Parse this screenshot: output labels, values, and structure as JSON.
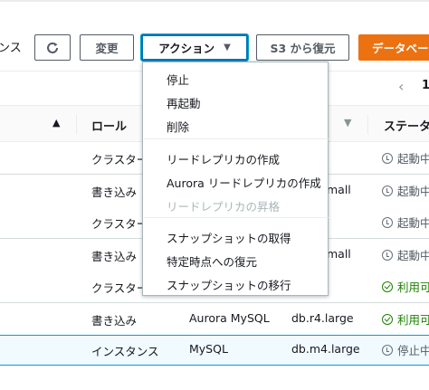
{
  "toolbar": {
    "left_label": "ンス",
    "edit_label": "変更",
    "action_label": "アクション",
    "s3_restore_label": "S3 から復元",
    "create_label": "データベー"
  },
  "pager": {
    "current_page": "1"
  },
  "table": {
    "headers": {
      "role": "ロール",
      "status": "ステータ"
    },
    "rows": [
      {
        "role": "クラスター",
        "engine": "",
        "size": "",
        "status": "起動中",
        "status_kind": "pending"
      },
      {
        "role": "書き込み",
        "engine": "",
        "size": "mall",
        "status": "起動中",
        "status_kind": "pending"
      },
      {
        "role": "クラスター",
        "engine": "",
        "size": "",
        "status": "起動中",
        "status_kind": "pending"
      },
      {
        "role": "書き込み",
        "engine": "",
        "size": "mall",
        "status": "起動中",
        "status_kind": "pending"
      },
      {
        "role": "クラスター",
        "engine": "",
        "size": "",
        "status": "利用可",
        "status_kind": "available"
      },
      {
        "role": "書き込み",
        "engine": "Aurora MySQL",
        "size": "db.r4.large",
        "status": "利用可",
        "status_kind": "available"
      },
      {
        "role": "インスタンス",
        "engine": "MySQL",
        "size": "db.m4.large",
        "status": "停止中",
        "status_kind": "pending"
      }
    ]
  },
  "action_menu": {
    "items": [
      {
        "label": "停止",
        "disabled": false
      },
      {
        "label": "再起動",
        "disabled": false
      },
      {
        "label": "削除",
        "disabled": false
      },
      {
        "label": "リードレプリカの作成",
        "disabled": false
      },
      {
        "label": "Aurora リードレプリカの作成",
        "disabled": false
      },
      {
        "label": "リードレプリカの昇格",
        "disabled": true
      },
      {
        "label": "スナップショットの取得",
        "disabled": false
      },
      {
        "label": "特定時点への復元",
        "disabled": false
      },
      {
        "label": "スナップショットの移行",
        "disabled": false
      }
    ]
  },
  "icons": {
    "refresh": "refresh-icon",
    "caret": "caret-down-icon",
    "prev": "chevron-left-icon",
    "sort": "sort-ascending-icon",
    "status_pending": "clock-icon",
    "status_available": "check-circle-icon"
  },
  "colors": {
    "primary": "#ec7211",
    "focus": "#0073bb",
    "selected_row": "#f1faff",
    "available": "#1d8102",
    "disabled_text": "#aab7b8"
  }
}
